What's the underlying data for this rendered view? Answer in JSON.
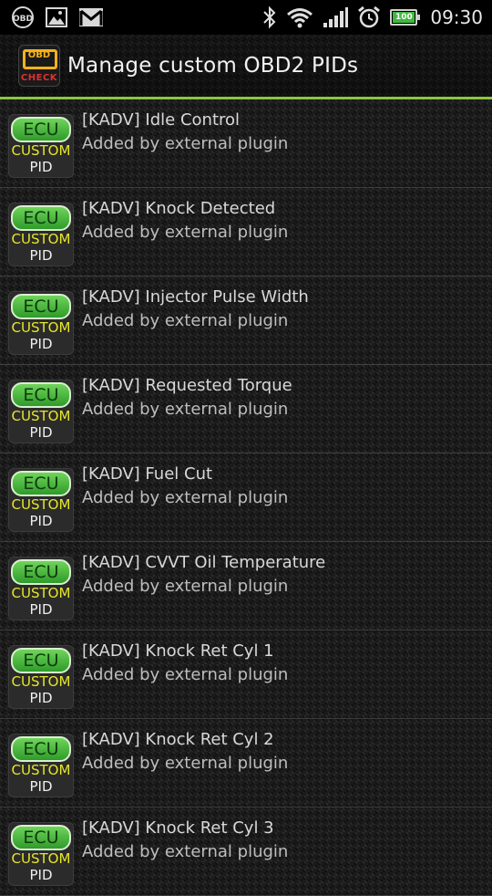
{
  "status_bar": {
    "left_icons": [
      "obd-notification-icon",
      "image-icon",
      "gmail-icon"
    ],
    "right_icons": [
      "bluetooth-icon",
      "wifi-icon",
      "signal-icon",
      "alarm-icon"
    ],
    "battery_level": "100",
    "battery_fraction": 1.0,
    "time": "09:30"
  },
  "header": {
    "icon_top_text": "OBD",
    "icon_bottom_text": "CHECK",
    "title": "Manage custom OBD2 PIDs",
    "accent_color": "#8cc63f"
  },
  "badge": {
    "line1": "ECU",
    "line2": "CUSTOM",
    "line3": "PID"
  },
  "pids": [
    {
      "name": "[KADV] Idle Control",
      "subtitle": "Added by external plugin"
    },
    {
      "name": "[KADV] Knock Detected",
      "subtitle": "Added by external plugin"
    },
    {
      "name": "[KADV] Injector Pulse Width",
      "subtitle": "Added by external plugin"
    },
    {
      "name": "[KADV] Requested Torque",
      "subtitle": "Added by external plugin"
    },
    {
      "name": "[KADV] Fuel Cut",
      "subtitle": "Added by external plugin"
    },
    {
      "name": "[KADV] CVVT Oil Temperature",
      "subtitle": "Added by external plugin"
    },
    {
      "name": "[KADV] Knock Ret Cyl 1",
      "subtitle": "Added by external plugin"
    },
    {
      "name": "[KADV] Knock Ret Cyl 2",
      "subtitle": "Added by external plugin"
    },
    {
      "name": "[KADV] Knock Ret Cyl 3",
      "subtitle": "Added by external plugin"
    }
  ]
}
